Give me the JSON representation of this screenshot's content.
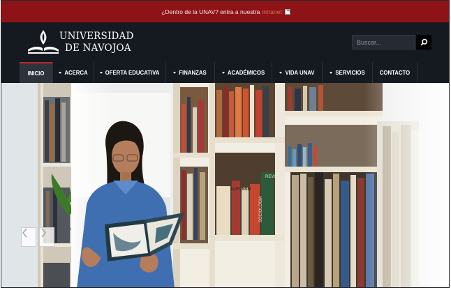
{
  "topbar": {
    "message": "¿Dentro de la UNAV? entra a nuestra",
    "link_label": "intranet",
    "link_icon": "external-link-icon"
  },
  "brand": {
    "line1": "UNIVERSIDAD",
    "line2": "DE NAVOJOA",
    "logo_icon": "book-flame-icon"
  },
  "search": {
    "placeholder": "Buscar...",
    "icon": "search-icon"
  },
  "nav": {
    "items": [
      {
        "label": "INICIO",
        "dropdown": false,
        "active": true
      },
      {
        "label": "ACERCA",
        "dropdown": true
      },
      {
        "label": "OFERTA EDUCATIVA",
        "dropdown": true
      },
      {
        "label": "FINANZAS",
        "dropdown": true
      },
      {
        "label": "ACADÉMICOS",
        "dropdown": true
      },
      {
        "label": "VIDA UNAV",
        "dropdown": true
      },
      {
        "label": "SERVICIOS",
        "dropdown": true
      },
      {
        "label": "CONTACTO",
        "dropdown": false
      }
    ]
  },
  "hero": {
    "book_spine_1": "ALFONSO",
    "book_spine_2": "REVU",
    "book_spine_3": "SOCIOLOGIA",
    "prev_icon": "chevron-left-icon",
    "next_icon": "chevron-right-icon"
  },
  "colors": {
    "topbar": "#8e1316",
    "header": "#151a21",
    "nav_active_border": "#c0262c",
    "link": "#e46a5c"
  }
}
